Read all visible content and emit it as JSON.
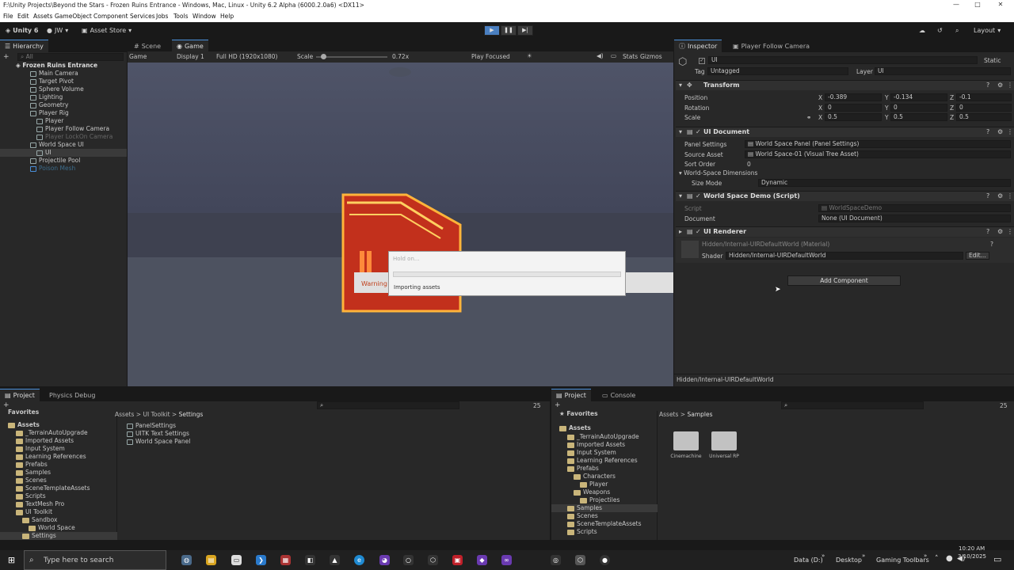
{
  "window": {
    "title": "F:\\Unity Projects\\Beyond the Stars - Frozen Ruins Entrance - Windows, Mac, Linux - Unity 6.2 Alpha (6000.2.0a6) <DX11>",
    "min": "—",
    "max": "□",
    "close": "✕"
  },
  "menu": [
    "File",
    "Edit",
    "Assets",
    "GameObject",
    "Component",
    "Services",
    "Jobs",
    "Tools",
    "Window",
    "Help"
  ],
  "toolbar": {
    "unity": "Unity 6",
    "account": "JW",
    "store": "Asset Store",
    "layout": "Layout",
    "play": "▶",
    "pause": "❚❚",
    "step": "▶|"
  },
  "hierarchy": {
    "tab": "Hierarchy",
    "search": "All",
    "scene": "Frozen Ruins Entrance",
    "items": [
      "Main Camera",
      "Target Pivot",
      "Sphere Volume",
      "Lighting",
      "Geometry",
      "Player Rig",
      "Player",
      "Player Follow Camera",
      "Player LockOn Camera",
      "World Space UI",
      "UI",
      "Projectile Pool",
      "Poison Mesh"
    ]
  },
  "game": {
    "tabs": [
      "Scene",
      "Game"
    ],
    "mode": "Game",
    "display": "Display 1",
    "resolution": "Full HD (1920x1080)",
    "scale_label": "Scale",
    "scale_value": "0.72x",
    "play_focused": "Play Focused",
    "stats": "Stats",
    "gizmos": "Gizmos",
    "scale_fraction": 0.1,
    "warning": "Warning"
  },
  "dialog": {
    "title": "Hold on...",
    "message": "Importing assets"
  },
  "inspector": {
    "tabs": [
      "Inspector",
      "Player Follow Camera"
    ],
    "name": "UI",
    "static": "Static",
    "tag_label": "Tag",
    "tag": "Untagged",
    "layer_label": "Layer",
    "layer": "UI",
    "transform": {
      "title": "Transform",
      "position": "Position",
      "rotation": "Rotation",
      "scale": "Scale",
      "pos": [
        "-0.389",
        "-0.134",
        "-0.1"
      ],
      "rot": [
        "0",
        "0",
        "0"
      ],
      "scl": [
        "0.5",
        "0.5",
        "0.5"
      ],
      "axes": [
        "X",
        "Y",
        "Z"
      ]
    },
    "uidoc": {
      "title": "UI Document",
      "panel_label": "Panel Settings",
      "panel": "World Space Panel (Panel Settings)",
      "source_label": "Source Asset",
      "source": "World Space-01 (Visual Tree Asset)",
      "sort_label": "Sort Order",
      "sort": "0",
      "wsd": "World-Space Dimensions",
      "size_label": "Size Mode",
      "size": "Dynamic"
    },
    "demo": {
      "title": "World Space Demo (Script)",
      "script_label": "Script",
      "script": "WorldSpaceDemo",
      "doc_label": "Document",
      "doc": "None (UI Document)"
    },
    "renderer": {
      "title": "UI Renderer",
      "material": "Hidden/Internal-UIRDefaultWorld (Material)",
      "shader_label": "Shader",
      "shader": "Hidden/Internal-UIRDefaultWorld",
      "edit": "Edit..."
    },
    "add_component": "Add Component",
    "footer": "Hidden/Internal-UIRDefaultWorld"
  },
  "project_left": {
    "tabs": [
      "Project",
      "Physics Debug"
    ],
    "favorites": "Favorites",
    "assets": "Assets",
    "tree": [
      "_TerrainAutoUpgrade",
      "Imported Assets",
      "Input System",
      "Learning References",
      "Prefabs",
      "Samples",
      "Scenes",
      "SceneTemplateAssets",
      "Scripts",
      "TextMesh Pro",
      "UI Toolkit",
      "Sandbox",
      "World Space",
      "Settings"
    ],
    "breadcrumb": [
      "Assets",
      "UI Toolkit",
      "Settings"
    ],
    "files": [
      "PanelSettings",
      "UITK Text Settings",
      "World Space Panel"
    ],
    "count": "25"
  },
  "project_right": {
    "tabs": [
      "Project",
      "Console"
    ],
    "favorites": "Favorites",
    "assets": "Assets",
    "tree": [
      "_TerrainAutoUpgrade",
      "Imported Assets",
      "Input System",
      "Learning References",
      "Prefabs",
      "Characters",
      "Player",
      "Weapons",
      "Projectiles",
      "Samples",
      "Scenes",
      "SceneTemplateAssets",
      "Scripts"
    ],
    "breadcrumb": [
      "Assets",
      "Samples"
    ],
    "folders": [
      "Cinemachine",
      "Universal RP"
    ],
    "count": "25"
  },
  "taskbar": {
    "search": "Type here to search",
    "data": "Data (D:)",
    "desktop": "Desktop",
    "gaming": "Gaming Toolbars",
    "time": "10:20 AM",
    "date": "3/10/2025",
    "overflow": "»"
  }
}
